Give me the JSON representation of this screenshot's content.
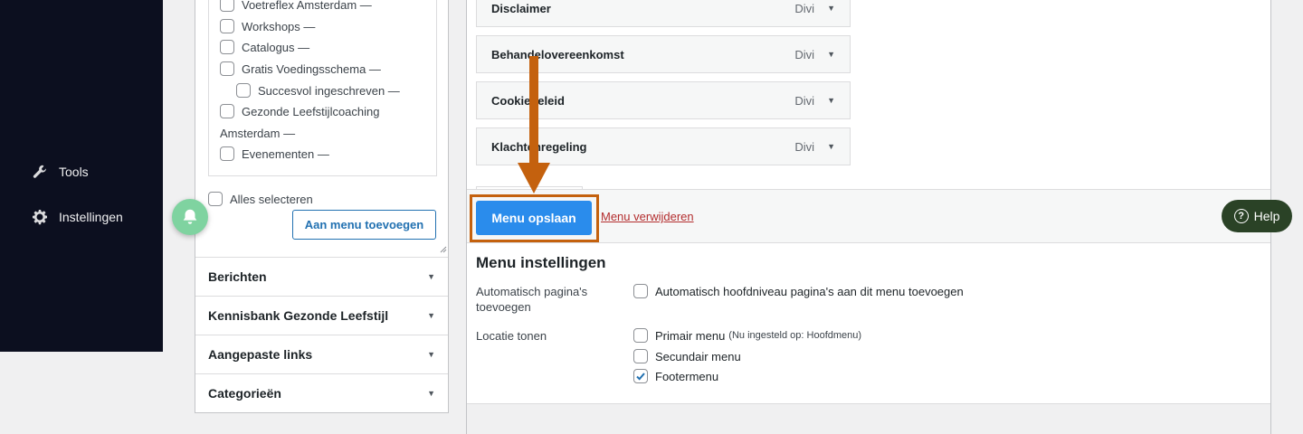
{
  "admin_menu": {
    "tools": {
      "label": "Tools",
      "icon": "wrench-icon"
    },
    "settings": {
      "label": "Instellingen",
      "icon": "gear-icon"
    }
  },
  "pages_list": {
    "items": [
      {
        "label": "Voetreflex Amsterdam —",
        "checked": false
      },
      {
        "label": "Workshops —",
        "checked": false
      },
      {
        "label": "Catalogus —",
        "checked": false
      },
      {
        "label": "Gratis Voedingsschema —",
        "checked": false
      },
      {
        "label": "Succesvol ingeschreven —",
        "checked": false
      },
      {
        "label": "Gezonde Leefstijlcoaching",
        "checked": false
      },
      {
        "label": "Amsterdam —"
      },
      {
        "label": "Evenementen —",
        "checked": false
      }
    ],
    "select_all": "Alles selecteren",
    "add_button": "Aan menu toevoegen"
  },
  "accordions": [
    "Berichten",
    "Kennisbank Gezonde Leefstijl",
    "Aangepaste links",
    "Categorieën"
  ],
  "menu_items": [
    {
      "title": "Disclaimer",
      "type": "Divi"
    },
    {
      "title": "Behandelovereenkomst",
      "type": "Divi"
    },
    {
      "title": "Cookiebeleid",
      "type": "Divi"
    },
    {
      "title": "Klachtenregeling",
      "type": "Divi"
    }
  ],
  "save_bar": {
    "save_button": "Menu opslaan",
    "delete_link": "Menu verwijderen"
  },
  "menu_settings": {
    "title": "Menu instellingen",
    "auto_add_label": "Automatisch pagina's toevoegen",
    "auto_add_option": "Automatisch hoofdniveau pagina's aan dit menu toevoegen",
    "location_label": "Locatie tonen",
    "locations": [
      {
        "label": "Primair menu",
        "note": "(Nu ingesteld op: Hoofdmenu)",
        "checked": false
      },
      {
        "label": "Secundair menu",
        "note": "",
        "checked": false
      },
      {
        "label": "Footermenu",
        "note": "",
        "checked": true
      }
    ]
  },
  "help": {
    "label": "Help"
  },
  "colors": {
    "accent": "#2a8cec",
    "highlight": "#c4610e",
    "danger": "#b32d2e",
    "sidebar": "#0c0f1f",
    "help_bg": "#2a4226",
    "bell": "#7fd3a0"
  }
}
